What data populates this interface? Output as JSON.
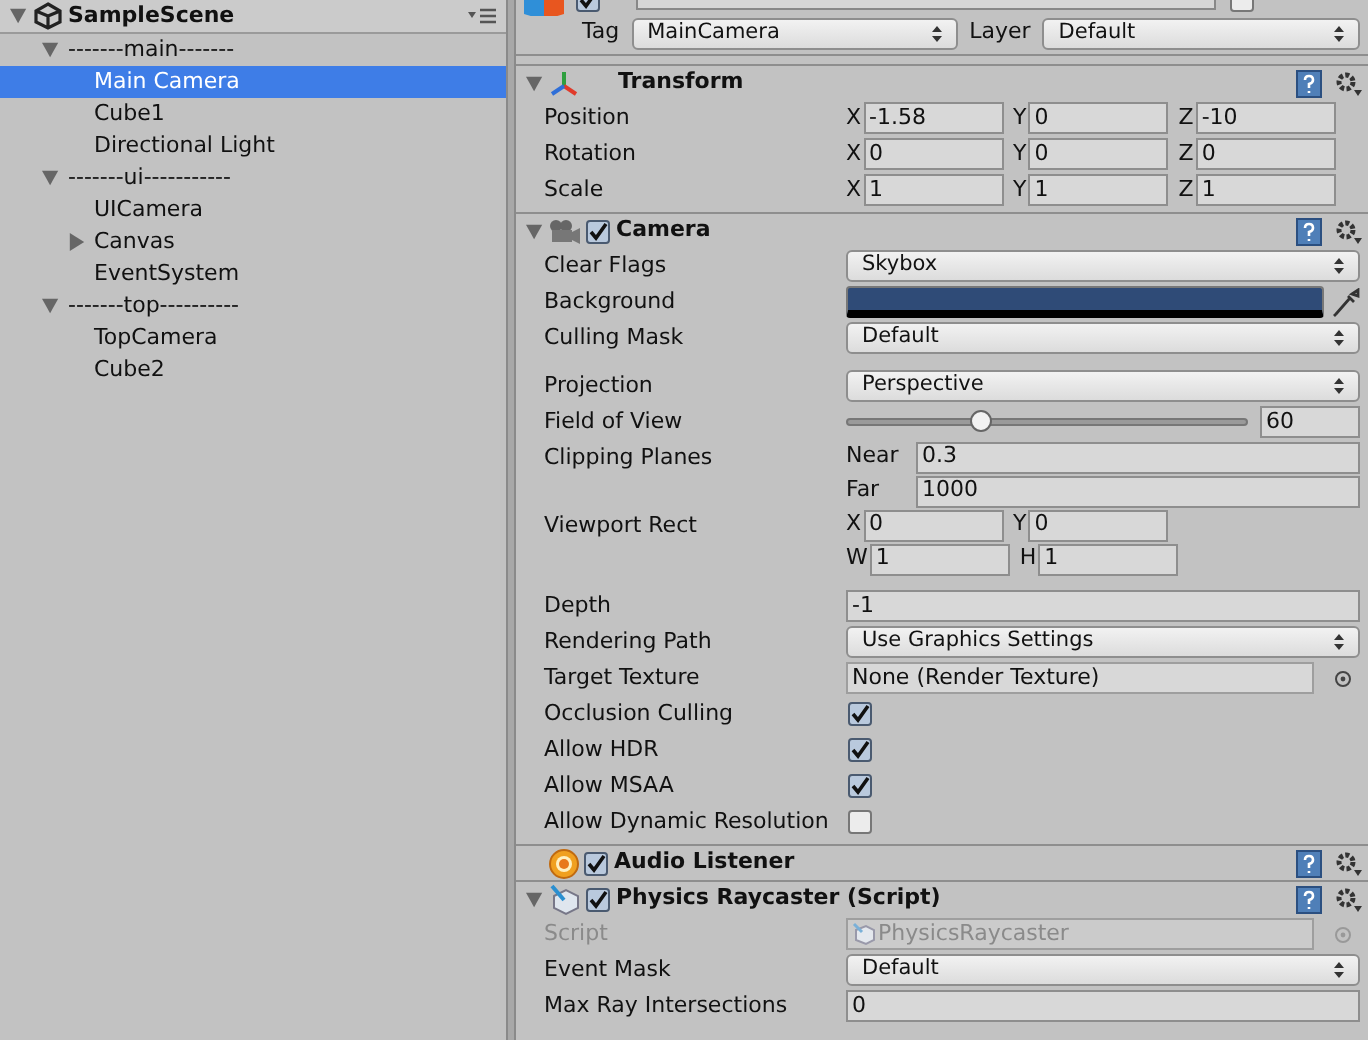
{
  "hierarchy": {
    "scene": "SampleScene",
    "items": [
      {
        "label": "-------main-------",
        "selected": false,
        "expanded": true,
        "children": [
          {
            "label": "Main Camera",
            "selected": true
          },
          {
            "label": "Cube1",
            "selected": false
          },
          {
            "label": "Directional Light",
            "selected": false
          }
        ]
      },
      {
        "label": "-------ui-----------",
        "selected": false,
        "expanded": true,
        "children": [
          {
            "label": "UICamera",
            "selected": false
          },
          {
            "label": "Canvas",
            "selected": false,
            "expanded": false
          },
          {
            "label": "EventSystem",
            "selected": false
          }
        ]
      },
      {
        "label": "-------top----------",
        "selected": false,
        "expanded": true,
        "children": [
          {
            "label": "TopCamera",
            "selected": false
          },
          {
            "label": "Cube2",
            "selected": false
          }
        ]
      }
    ]
  },
  "inspector": {
    "active": true,
    "static": false,
    "tag_label": "Tag",
    "tag": "MainCamera",
    "layer_label": "Layer",
    "layer": "Default",
    "components": [
      {
        "kind": "transform",
        "name": "Transform",
        "expanded": true,
        "sections": [
          [
            {
              "kind": "grid",
              "label": "Position",
              "rows": [
                [
                  {
                    "axis": "X",
                    "value": "-1.58"
                  },
                  {
                    "axis": "Y",
                    "value": "0"
                  },
                  {
                    "axis": "Z",
                    "value": "-10"
                  }
                ]
              ]
            },
            {
              "kind": "grid",
              "label": "Rotation",
              "rows": [
                [
                  {
                    "axis": "X",
                    "value": "0"
                  },
                  {
                    "axis": "Y",
                    "value": "0"
                  },
                  {
                    "axis": "Z",
                    "value": "0"
                  }
                ]
              ]
            },
            {
              "kind": "grid",
              "label": "Scale",
              "rows": [
                [
                  {
                    "axis": "X",
                    "value": "1"
                  },
                  {
                    "axis": "Y",
                    "value": "1"
                  },
                  {
                    "axis": "Z",
                    "value": "1"
                  }
                ]
              ]
            }
          ]
        ]
      },
      {
        "kind": "camera",
        "name": "Camera",
        "enabled": true,
        "expanded": true,
        "sections": [
          [
            {
              "kind": "dropdown",
              "label": "Clear Flags",
              "value": "Skybox"
            },
            {
              "kind": "color",
              "label": "Background",
              "color": "#2f4b77"
            },
            {
              "kind": "dropdown",
              "label": "Culling Mask",
              "value": "Default"
            }
          ],
          [
            {
              "kind": "dropdown",
              "label": "Projection",
              "value": "Perspective"
            },
            {
              "kind": "slider",
              "label": "Field of View",
              "level": 0.33,
              "value": "60"
            },
            {
              "kind": "grid",
              "label": "Clipping Planes",
              "rows": [
                [
                  {
                    "axis": "Near",
                    "value": "0.3"
                  }
                ],
                [
                  {
                    "axis": "Far",
                    "value": "1000"
                  }
                ]
              ]
            },
            {
              "kind": "grid",
              "label": "Viewport Rect",
              "rows": [
                [
                  {
                    "axis": "X",
                    "value": "0"
                  },
                  {
                    "axis": "Y",
                    "value": "0"
                  }
                ],
                [
                  {
                    "axis": "W",
                    "value": "1"
                  },
                  {
                    "axis": "H",
                    "value": "1"
                  }
                ]
              ]
            }
          ],
          [
            {
              "kind": "field",
              "label": "Depth",
              "value": "-1"
            },
            {
              "kind": "dropdown",
              "label": "Rendering Path",
              "value": "Use Graphics Settings"
            },
            {
              "kind": "object",
              "label": "Target Texture",
              "value": "None (Render Texture)",
              "disabled": false
            },
            {
              "kind": "checkbox",
              "label": "Occlusion Culling",
              "checked": true
            },
            {
              "kind": "checkbox",
              "label": "Allow HDR",
              "checked": true
            },
            {
              "kind": "checkbox",
              "label": "Allow MSAA",
              "checked": true
            },
            {
              "kind": "checkbox",
              "label": "Allow Dynamic Resolution",
              "checked": false
            }
          ]
        ]
      },
      {
        "kind": "audio",
        "name": "Audio Listener",
        "enabled": true
      },
      {
        "kind": "script",
        "name": "Physics Raycaster (Script)",
        "enabled": true,
        "expanded": true,
        "sections": [
          [
            {
              "kind": "object",
              "label": "Script",
              "value": "PhysicsRaycaster",
              "disabled": true
            },
            {
              "kind": "dropdown",
              "label": "Event Mask",
              "value": "Default"
            },
            {
              "kind": "field",
              "label": "Max Ray Intersections",
              "value": "0"
            }
          ]
        ]
      }
    ]
  }
}
